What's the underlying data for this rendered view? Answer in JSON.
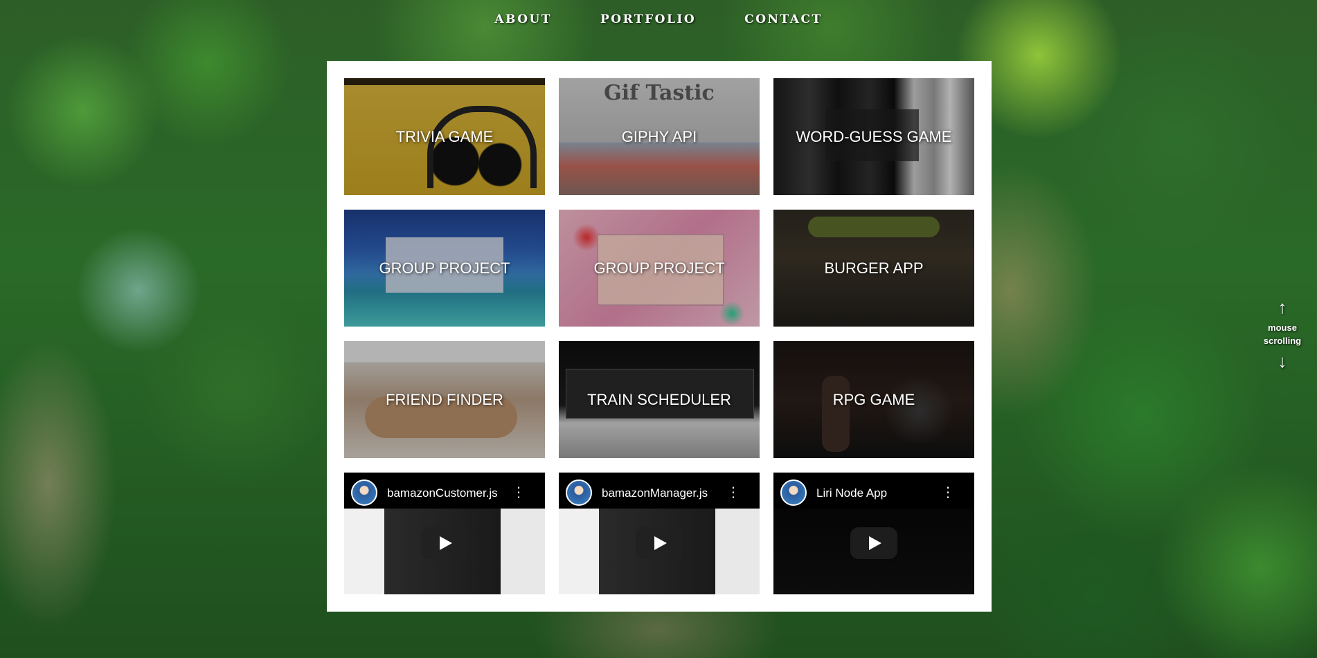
{
  "nav": {
    "items": [
      "ABOUT",
      "PORTFOLIO",
      "CONTACT"
    ]
  },
  "portfolio": {
    "projects": [
      {
        "title": "TRIVIA GAME",
        "icon": "trivia-cover-image"
      },
      {
        "title": "GIPHY API",
        "icon": "giphy-cover-image",
        "logo_text": "Gif Tastic"
      },
      {
        "title": "WORD-GUESS GAME",
        "icon": "word-guess-cover-image"
      },
      {
        "title": "GROUP PROJECT",
        "icon": "group-project-cover-image"
      },
      {
        "title": "GROUP PROJECT",
        "icon": "group-project-cover-image"
      },
      {
        "title": "BURGER APP",
        "icon": "burger-cover-image"
      },
      {
        "title": "FRIEND FINDER",
        "icon": "friend-finder-cover-image"
      },
      {
        "title": "TRAIN SCHEDULER",
        "icon": "train-cover-image"
      },
      {
        "title": "RPG GAME",
        "icon": "rpg-cover-image"
      }
    ],
    "videos": [
      {
        "title": "bamazonCustomer.js",
        "icon": "channel-avatar"
      },
      {
        "title": "bamazonManager.js",
        "icon": "channel-avatar"
      },
      {
        "title": "Liri Node App",
        "icon": "channel-avatar"
      }
    ],
    "video_menu_glyph": "⋮"
  },
  "scroll_hint": {
    "up": "↑",
    "line1": "mouse",
    "line2": "scrolling",
    "down": "↓"
  },
  "colors": {
    "panel": "#ffffff",
    "nav_text": "#ffffff",
    "video_bg": "#000000"
  }
}
